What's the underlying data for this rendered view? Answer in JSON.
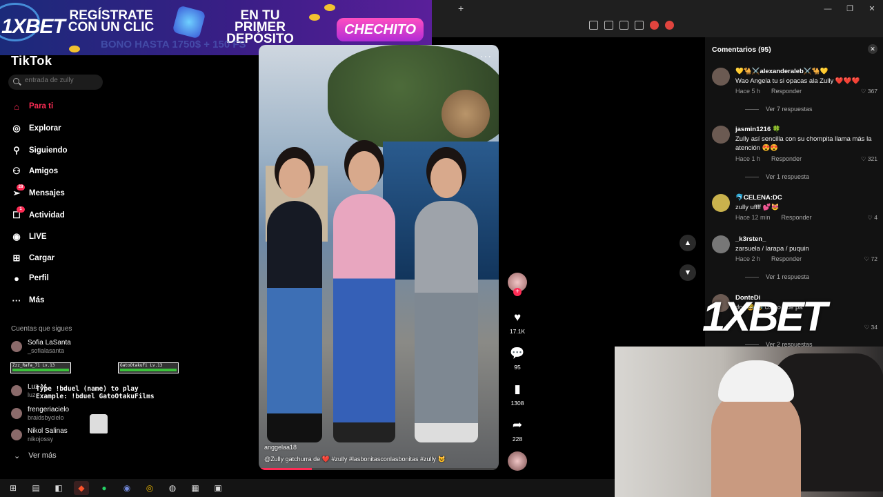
{
  "ad": {
    "logo": "1XBET",
    "headline1": "REGÍSTRATE CON UN CLIC",
    "headline2": "EN TU PRIMER DEPÓSITO",
    "cta": "CHECHITO",
    "bono": "BONO HASTA 1750$ + 150 FS",
    "big_logo": "1XBET"
  },
  "app": {
    "brand": "TikTok"
  },
  "search": {
    "placeholder": "entrada de zully"
  },
  "nav": [
    {
      "label": "Para ti",
      "icon": "home-icon",
      "active": true
    },
    {
      "label": "Explorar",
      "icon": "compass-icon"
    },
    {
      "label": "Siguiendo",
      "icon": "person-icon"
    },
    {
      "label": "Amigos",
      "icon": "friends-icon"
    },
    {
      "label": "Mensajes",
      "icon": "send-icon",
      "badge": "28"
    },
    {
      "label": "Actividad",
      "icon": "inbox-icon",
      "badge": "1"
    },
    {
      "label": "LIVE",
      "icon": "live-icon"
    },
    {
      "label": "Cargar",
      "icon": "upload-icon"
    },
    {
      "label": "Perfil",
      "icon": "profile-icon"
    },
    {
      "label": "Más",
      "icon": "more-icon"
    }
  ],
  "following": {
    "title": "Cuentas que sigues",
    "accounts": [
      {
        "name": "Sofia LaSanta",
        "handle": "_sofialasanta"
      },
      {
        "name": "Luz M",
        "handle": "luz"
      },
      {
        "name": "frengeriacielo",
        "handle": "braidsbycielo"
      },
      {
        "name": "Nikol Salinas",
        "handle": "nikojossy"
      }
    ],
    "more": "Ver más"
  },
  "overlay": {
    "player1": "Zzz_Rafa_71 Lv.13",
    "player2": "GatoOtakuFi Lv.13",
    "line1": "Type !bduel (name) to play",
    "line2": "Example: !bduel GatoOtakuFilms"
  },
  "video": {
    "author": "anggelaa18",
    "caption": "@Zully  gatchurra de ❤️ #zully #lasbonitasconlasbonitas #zully 😺",
    "progress": 0.22
  },
  "actions": {
    "likes": "17.1K",
    "comments": "95",
    "saves": "1308",
    "shares": "228"
  },
  "comments": {
    "header": "Comentarios (95)",
    "items": [
      {
        "user": "💛🐪⚔️alexanderaleb⚔️🐪💛",
        "text": "Wao Angela tu si opacas ala Zully ❤️❤️❤️",
        "time": "Hace 5 h",
        "reply": "Responder",
        "likes": "367",
        "replies": "Ver 7 respuestas"
      },
      {
        "user": "jasmin1216 🍀",
        "text": "Zully así sencilla con su chompita llama más la atención 😍😍",
        "time": "Hace 1 h",
        "reply": "Responder",
        "likes": "321",
        "replies": "Ver 1 respuesta"
      },
      {
        "user": "🐬CELENA:DC",
        "text": "zully uffff 💕😻",
        "time": "Hace 12 min",
        "reply": "Responder",
        "likes": "4"
      },
      {
        "user": "_k3rsten_",
        "text": "zarsuela / larapa / puquin",
        "time": "Hace 2 h",
        "reply": "Responder",
        "likes": "72",
        "replies": "Ver 1 respuesta"
      },
      {
        "user": "DonteDi",
        "text": "dor 😂😂 como que pa",
        "likes": "34",
        "replies": "Ver 2 respuestas"
      }
    ]
  },
  "colors": {
    "accent": "#fe2c55",
    "panel": "#121212"
  }
}
